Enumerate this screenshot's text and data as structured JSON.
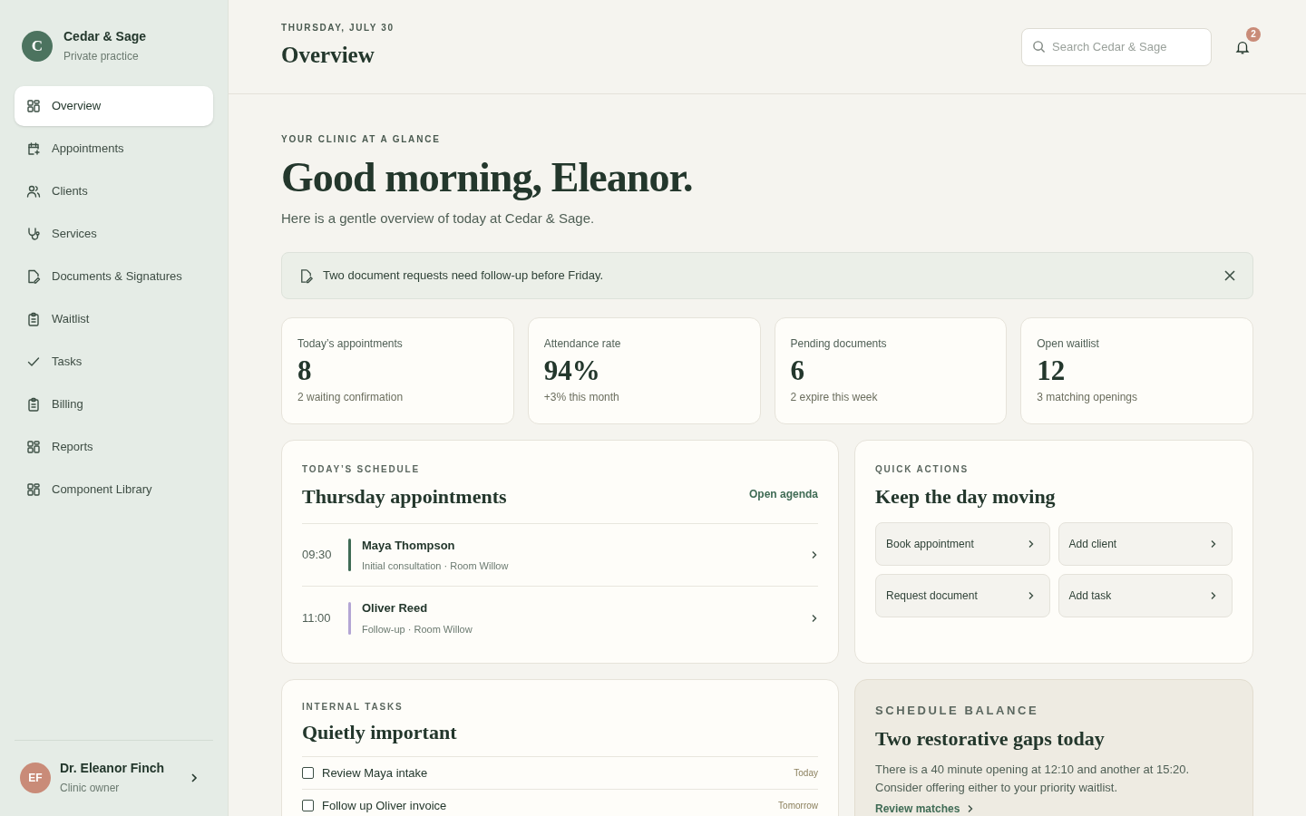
{
  "brand": {
    "initial": "C",
    "name": "Cedar & Sage",
    "subtitle": "Private practice"
  },
  "nav": [
    {
      "label": "Overview",
      "selected": true
    },
    {
      "label": "Appointments",
      "selected": false
    },
    {
      "label": "Clients",
      "selected": false
    },
    {
      "label": "Services",
      "selected": false
    },
    {
      "label": "Documents & Signatures",
      "selected": false
    },
    {
      "label": "Waitlist",
      "selected": false
    },
    {
      "label": "Tasks",
      "selected": false
    },
    {
      "label": "Billing",
      "selected": false
    },
    {
      "label": "Reports",
      "selected": false
    },
    {
      "label": "Component Library",
      "selected": false
    }
  ],
  "user": {
    "initials": "EF",
    "name": "Dr. Eleanor Finch",
    "role": "Clinic owner"
  },
  "header": {
    "date": "THURSDAY, JULY 30",
    "title": "Overview",
    "search": {
      "placeholder": "Search Cedar & Sage"
    },
    "notifications": "2"
  },
  "greeting": {
    "eyebrow": "YOUR CLINIC AT A GLANCE",
    "title": "Good morning, Eleanor.",
    "subtitle": "Here is a gentle overview of today at Cedar & Sage."
  },
  "alert": {
    "text": "Two document requests need follow-up before Friday."
  },
  "stats": [
    {
      "label": "Today’s appointments",
      "value": "8",
      "note": "2 waiting confirmation"
    },
    {
      "label": "Attendance rate",
      "value": "94%",
      "note": "+3% this month"
    },
    {
      "label": "Pending documents",
      "value": "6",
      "note": "2 expire this week"
    },
    {
      "label": "Open waitlist",
      "value": "12",
      "note": "3 matching openings"
    }
  ],
  "schedule": {
    "eyebrow": "TODAY’S SCHEDULE",
    "title": "Thursday appointments",
    "link": "Open agenda",
    "rows": [
      {
        "time": "09:30",
        "name": "Maya Thompson",
        "detail": "Initial consultation · Room Willow",
        "color": "#3f6b55"
      },
      {
        "time": "11:00",
        "name": "Oliver Reed",
        "detail": "Follow-up · Room Willow",
        "color": "#b3a6d4"
      }
    ]
  },
  "quick_actions": {
    "eyebrow": "QUICK ACTIONS",
    "title": "Keep the day moving",
    "actions": [
      "Book appointment",
      "Add client",
      "Request document",
      "Add task"
    ]
  },
  "tasks": {
    "eyebrow": "INTERNAL TASKS",
    "title": "Quietly important",
    "items": [
      {
        "label": "Review Maya intake",
        "due": "Today",
        "checked": false
      },
      {
        "label": "Follow up Oliver invoice",
        "due": "Tomorrow",
        "checked": false
      }
    ]
  },
  "balance": {
    "eyebrow": "SCHEDULE BALANCE",
    "title": "Two restorative gaps today",
    "text": "There is a 40 minute opening at 12:10 and another at 15:20. Consider offering either to your priority waitlist.",
    "link": "Review matches"
  }
}
